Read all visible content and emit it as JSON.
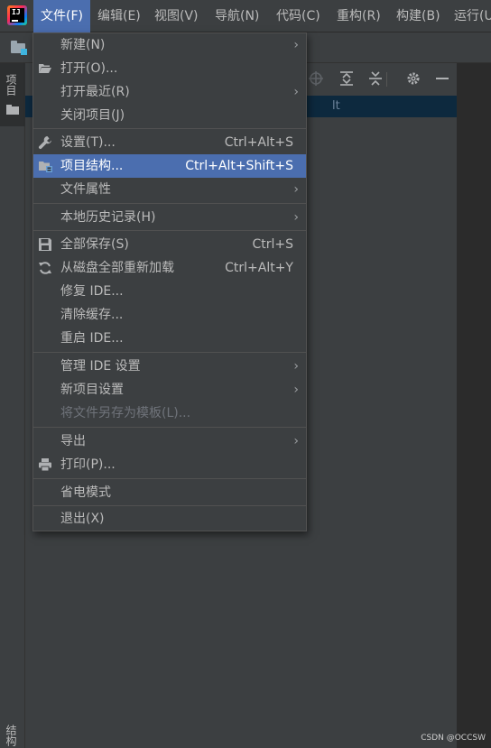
{
  "menubar": {
    "items": [
      {
        "label": "文件(F)",
        "active": true
      },
      {
        "label": "编辑(E)"
      },
      {
        "label": "视图(V)"
      },
      {
        "label": "导航(N)"
      },
      {
        "label": "代码(C)"
      },
      {
        "label": "重构(R)"
      },
      {
        "label": "构建(B)"
      },
      {
        "label": "运行(U"
      }
    ]
  },
  "left_strip": {
    "top_tab": "项目",
    "bottom_tab": "结构"
  },
  "panel": {
    "selected_row_text": "lt"
  },
  "file_menu": {
    "items": [
      {
        "label": "新建(N)",
        "submenu": true
      },
      {
        "label": "打开(O)...",
        "icon": "folder-open-icon"
      },
      {
        "label": "打开最近(R)",
        "submenu": true
      },
      {
        "label": "关闭项目(J)"
      },
      {
        "label": "设置(T)...",
        "shortcut": "Ctrl+Alt+S",
        "icon": "wrench-icon"
      },
      {
        "label": "项目结构...",
        "shortcut": "Ctrl+Alt+Shift+S",
        "icon": "project-structure-icon",
        "highlighted": true
      },
      {
        "label": "文件属性",
        "submenu": true
      },
      {
        "label": "本地历史记录(H)",
        "submenu": true
      },
      {
        "label": "全部保存(S)",
        "shortcut": "Ctrl+S",
        "icon": "save-icon"
      },
      {
        "label": "从磁盘全部重新加载",
        "shortcut": "Ctrl+Alt+Y",
        "icon": "reload-icon"
      },
      {
        "label": "修复 IDE..."
      },
      {
        "label": "清除缓存..."
      },
      {
        "label": "重启 IDE..."
      },
      {
        "label": "管理 IDE 设置",
        "submenu": true
      },
      {
        "label": "新项目设置",
        "submenu": true
      },
      {
        "label": "将文件另存为模板(L)...",
        "disabled": true
      },
      {
        "label": "导出",
        "submenu": true
      },
      {
        "label": "打印(P)...",
        "icon": "print-icon"
      },
      {
        "label": "省电模式"
      },
      {
        "label": "退出(X)"
      }
    ]
  },
  "watermark": "CSDN @OCCSW",
  "colors": {
    "background": "#3c3f41",
    "highlight": "#4b6eaf",
    "selection": "#0d293e"
  }
}
